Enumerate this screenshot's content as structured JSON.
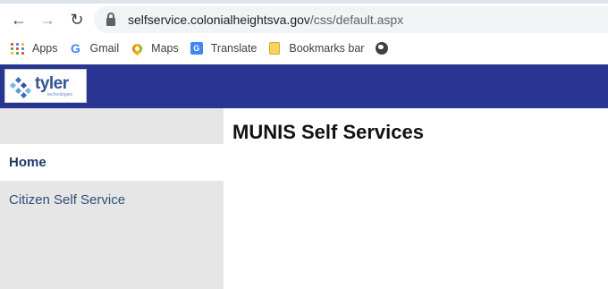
{
  "browser": {
    "url_host": "selfservice.colonialheightsva.gov",
    "url_path": "/css/default.aspx"
  },
  "bookmarks": {
    "items": [
      "Apps",
      "Gmail",
      "Maps",
      "Translate",
      "Bookmarks bar"
    ]
  },
  "header": {
    "logo_word": "tyler",
    "logo_sub": "technologies",
    "bg_color": "#283593"
  },
  "sidebar": {
    "items": [
      {
        "label": "Home",
        "active": true
      },
      {
        "label": "Citizen Self Service",
        "active": false
      }
    ]
  },
  "main": {
    "title": "MUNIS Self Services"
  }
}
